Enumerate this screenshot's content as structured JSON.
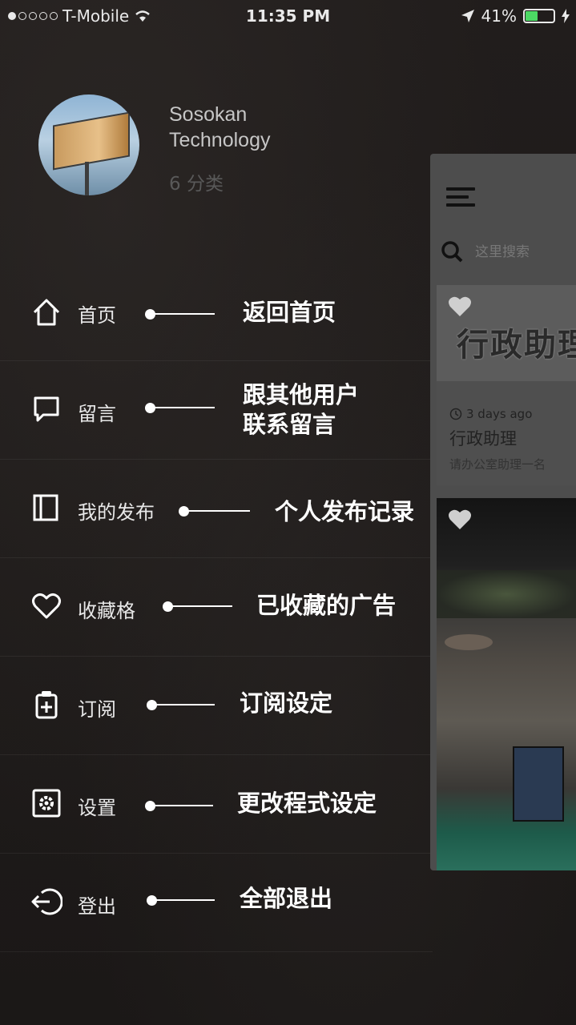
{
  "status_bar": {
    "carrier": "T-Mobile",
    "signal_dots": 5,
    "signal_filled": 1,
    "time": "11:35 PM",
    "battery": "41%",
    "battery_fraction": 0.41,
    "battery_color": "#4cd964"
  },
  "profile": {
    "name": "Sosokan Technology",
    "category_count": "6 分类"
  },
  "menu": [
    {
      "label": "首页",
      "icon": "home-icon",
      "annotation": "返回首页"
    },
    {
      "label": "留言",
      "icon": "chat-bubble-icon",
      "annotation": "跟其他用户\n联系留言"
    },
    {
      "label": "我的发布",
      "icon": "book-icon",
      "annotation": "个人发布记录"
    },
    {
      "label": "收藏格",
      "icon": "heart-icon",
      "annotation": "已收藏的广告"
    },
    {
      "label": "订阅",
      "icon": "clipboard-plus-icon",
      "annotation": "订阅设定"
    },
    {
      "label": "设置",
      "icon": "settings-icon",
      "annotation": "更改程式设定"
    },
    {
      "label": "登出",
      "icon": "logout-icon",
      "annotation": "全部退出"
    }
  ],
  "app_preview": {
    "search_placeholder": "这里搜索",
    "card1": {
      "image_text": "行政助理",
      "time": "3 days ago",
      "title": "行政助理",
      "description": "请办公室助理一名"
    }
  }
}
